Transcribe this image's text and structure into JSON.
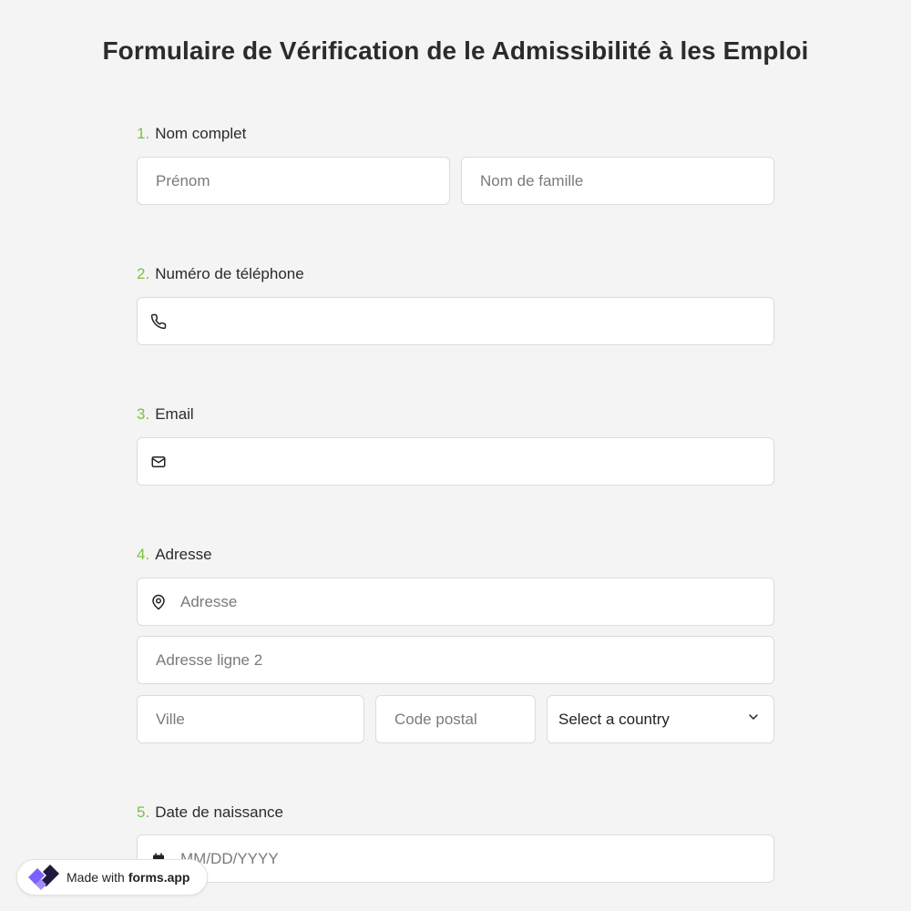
{
  "form": {
    "title": "Formulaire de Vérification de le Admissibilité à les Emploi"
  },
  "questions": [
    {
      "number": "1.",
      "label": "Nom complet"
    },
    {
      "number": "2.",
      "label": "Numéro de téléphone"
    },
    {
      "number": "3.",
      "label": "Email"
    },
    {
      "number": "4.",
      "label": "Adresse"
    },
    {
      "number": "5.",
      "label": "Date de naissance"
    }
  ],
  "fields": {
    "first_name_placeholder": "Prénom",
    "last_name_placeholder": "Nom de famille",
    "phone_icon": "phone-icon",
    "email_icon": "mail-icon",
    "address_icon": "map-pin-icon",
    "address_placeholder": "Adresse",
    "address_line2_placeholder": "Adresse ligne 2",
    "city_placeholder": "Ville",
    "postal_code_placeholder": "Code postal",
    "country_select_value": "Select a country",
    "date_icon": "calendar-icon",
    "date_placeholder": "MM/DD/YYYY"
  },
  "badge": {
    "prefix": "Made with",
    "brand": "forms.app"
  },
  "colors": {
    "accent_green": "#7bc144",
    "background": "#f4f4f4",
    "brand_purple": "#7b61ff",
    "brand_dark": "#1f1a3d"
  }
}
